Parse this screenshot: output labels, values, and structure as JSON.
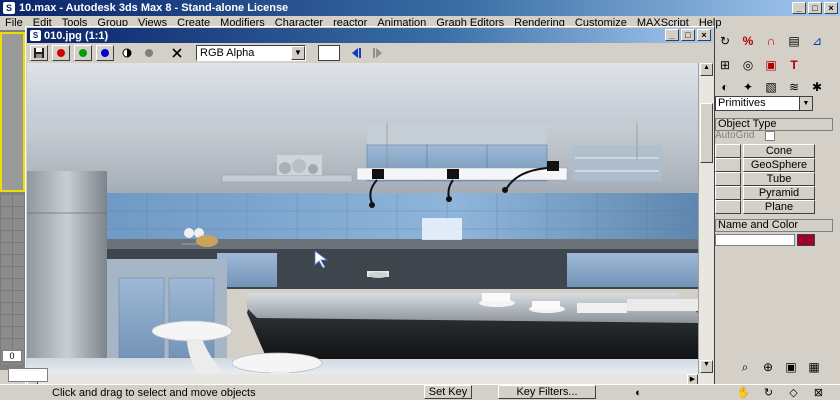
{
  "main_title": "10.max - Autodesk 3ds Max 8  - Stand-alone License",
  "menu": [
    "File",
    "Edit",
    "Tools",
    "Group",
    "Views",
    "Create",
    "Modifiers",
    "Character",
    "reactor",
    "Animation",
    "Graph Editors",
    "Rendering",
    "Customize",
    "MAXScript",
    "Help"
  ],
  "viewer": {
    "title": "010.jpg (1:1)",
    "channel": "RGB Alpha",
    "channel_colors": {
      "red": "#d40000",
      "green": "#00a000",
      "blue": "#0000d0"
    }
  },
  "right_panel": {
    "category": "Primitives",
    "rollout_object_type": "Object Type",
    "autogrid_label": "AutoGrid",
    "buttons": [
      "Cone",
      "GeoSphere",
      "Tube",
      "Pyramid",
      "Plane"
    ],
    "rollout_name_color": "Name and Color",
    "object_color": "#a00030"
  },
  "left_viewport_value": "0",
  "status": {
    "message": "Click and drag to select and move objects",
    "set_key": "Set Key",
    "key_filters": "Key Filters..."
  },
  "accent_colors": {
    "title_bar": "#0a246a",
    "viewport_active": "#e8e000"
  }
}
